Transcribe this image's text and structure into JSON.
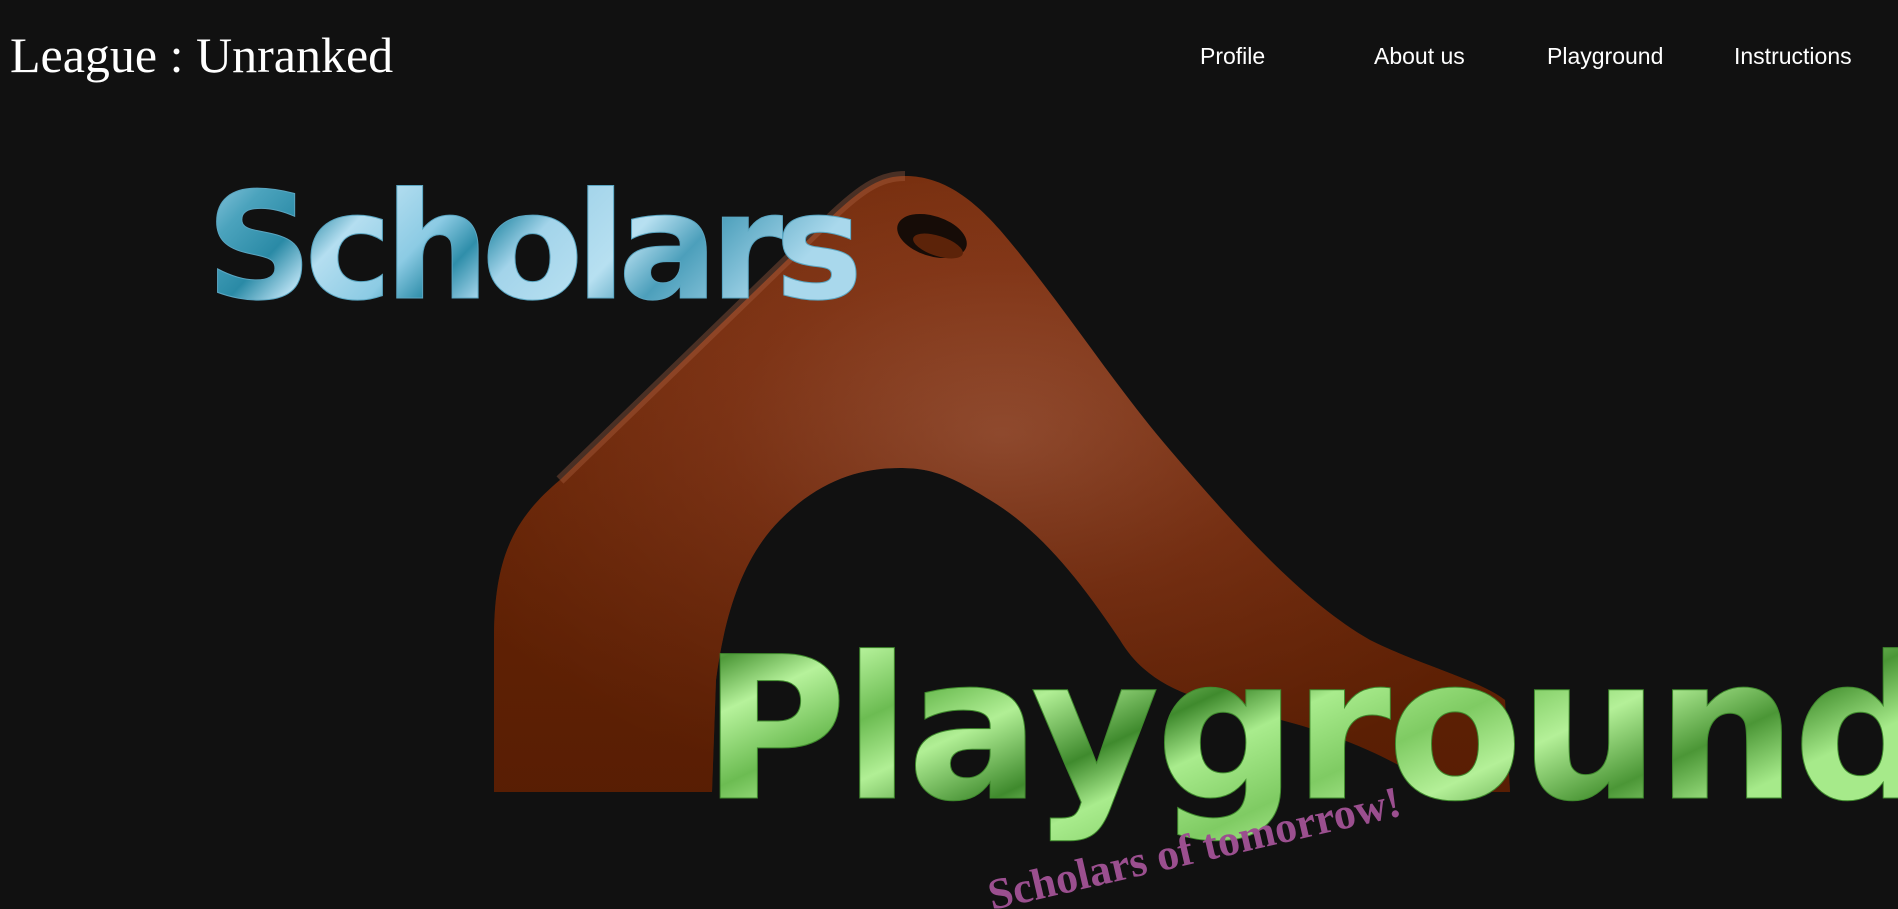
{
  "header": {
    "league_label": "League : Unranked"
  },
  "nav": {
    "items": [
      {
        "label": "Profile"
      },
      {
        "label": "About us"
      },
      {
        "label": "Playground"
      },
      {
        "label": "Instructions"
      }
    ]
  },
  "hero": {
    "title_line1": "Scholars",
    "title_line2": "Playground",
    "tagline": "Scholars of tomorrow!",
    "colors": {
      "background": "#111111",
      "slide": "#7a2e08",
      "scholars_text": "#9fd2ea",
      "playground_text": "#9be07f",
      "tagline": "#9b4f8f"
    }
  }
}
